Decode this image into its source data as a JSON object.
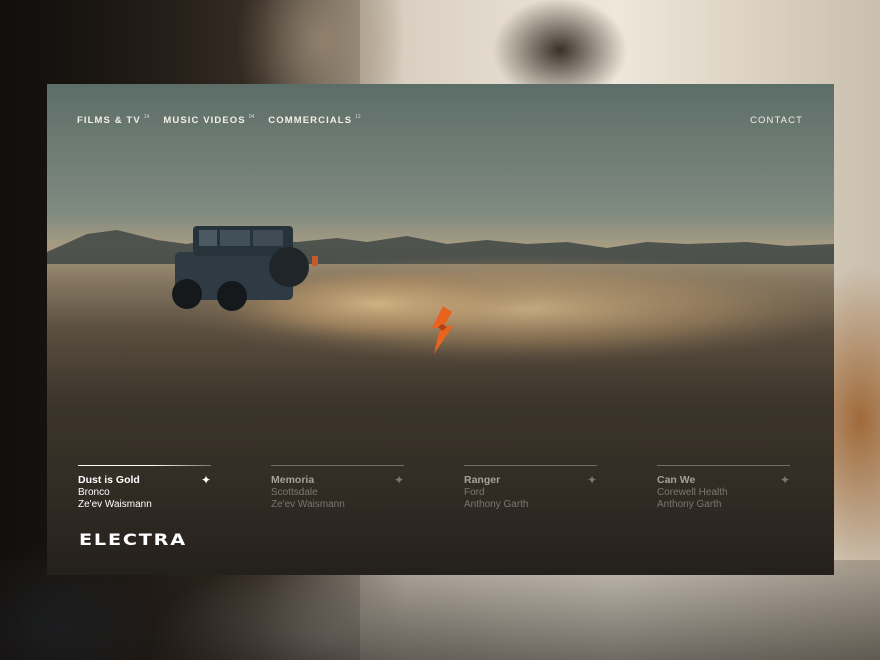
{
  "nav": {
    "items": [
      {
        "label": "FILMS & TV",
        "count": "14"
      },
      {
        "label": "MUSIC VIDEOS",
        "count": "04"
      },
      {
        "label": "COMMERCIALS",
        "count": "12"
      }
    ],
    "contact": "CONTACT"
  },
  "projects": [
    {
      "title": "Dust is Gold",
      "client": "Bronco",
      "director": "Ze'ev Waismann",
      "active": true
    },
    {
      "title": "Memoria",
      "client": "Scottsdale",
      "director": "Ze'ev Waismann",
      "active": false
    },
    {
      "title": "Ranger",
      "client": "Ford",
      "director": "Anthony Garth",
      "active": false
    },
    {
      "title": "Can We",
      "client": "Corewell Health",
      "director": "Anthony Garth",
      "active": false
    }
  ],
  "brand": "ELECTRA",
  "icons": {
    "plus": "plus-icon",
    "mark": "bolt-diamond-icon"
  },
  "colors": {
    "accent": "#e8631e",
    "text": "#ffffff"
  }
}
